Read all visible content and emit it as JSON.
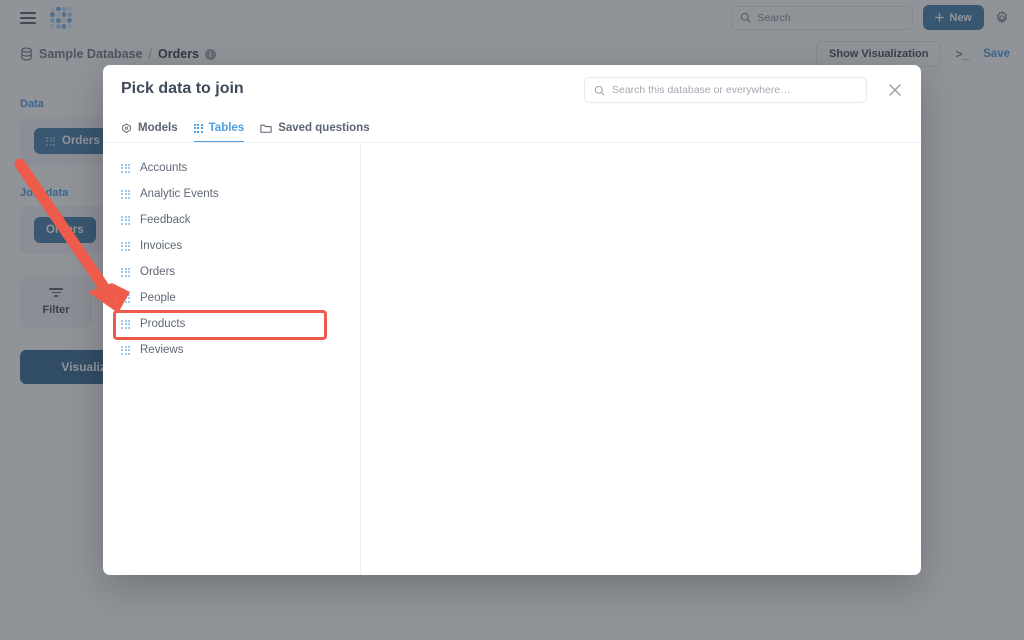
{
  "app": {
    "name": "Metabase",
    "logo_icon": "metabase-dots-logo",
    "menu_icon": "hamburger-menu-icon"
  },
  "topnav": {
    "search": {
      "placeholder": "Search",
      "icon": "search-icon",
      "value": ""
    },
    "new_button": {
      "label": "New",
      "icon": "plus-icon"
    },
    "settings_icon": "gear-icon"
  },
  "question_header": {
    "breadcrumb": {
      "database_icon": "database-icon",
      "database": "Sample Database",
      "separator": "/",
      "table": "Orders",
      "info_icon": "info-icon"
    },
    "show_visualization_label": "Show Visualization",
    "console_icon": "native-query-console-icon",
    "save_label": "Save"
  },
  "notebook": {
    "data_section_label": "Data",
    "data_table_pill": "Orders",
    "join_section_label": "Join data",
    "join_table_pill": "Orders",
    "join_type_icon": "venn-diagram-icon",
    "filter_label": "Filter",
    "filter_icon": "filter-icon",
    "visualize_label": "Visualize"
  },
  "modal": {
    "title": "Pick data to join",
    "search": {
      "placeholder": "Search this database or everywhere…",
      "icon": "search-icon",
      "value": ""
    },
    "close_icon": "close-icon",
    "tabs": [
      {
        "label": "Models",
        "icon": "model-cube-icon",
        "active": false
      },
      {
        "label": "Tables",
        "icon": "table-grid-icon",
        "active": true
      },
      {
        "label": "Saved questions",
        "icon": "folder-icon",
        "active": false
      }
    ],
    "tables": [
      {
        "label": "Accounts",
        "icon": "table-grid-icon"
      },
      {
        "label": "Analytic Events",
        "icon": "table-grid-icon"
      },
      {
        "label": "Feedback",
        "icon": "table-grid-icon"
      },
      {
        "label": "Invoices",
        "icon": "table-grid-icon"
      },
      {
        "label": "Orders",
        "icon": "table-grid-icon"
      },
      {
        "label": "People",
        "icon": "table-grid-icon"
      },
      {
        "label": "Products",
        "icon": "table-grid-icon"
      },
      {
        "label": "Reviews",
        "icon": "table-grid-icon"
      }
    ]
  },
  "annotation": {
    "highlight_target": "Products",
    "arrow_color": "#ee5b4a",
    "highlight_color": "#ee5b4a"
  },
  "colors": {
    "brand_blue": "#509ee3",
    "button_blue": "#4a7fab",
    "overlay": "rgba(43,50,59,0.52)",
    "text_dark": "#3f4a5a",
    "text_muted": "#5f6876"
  }
}
